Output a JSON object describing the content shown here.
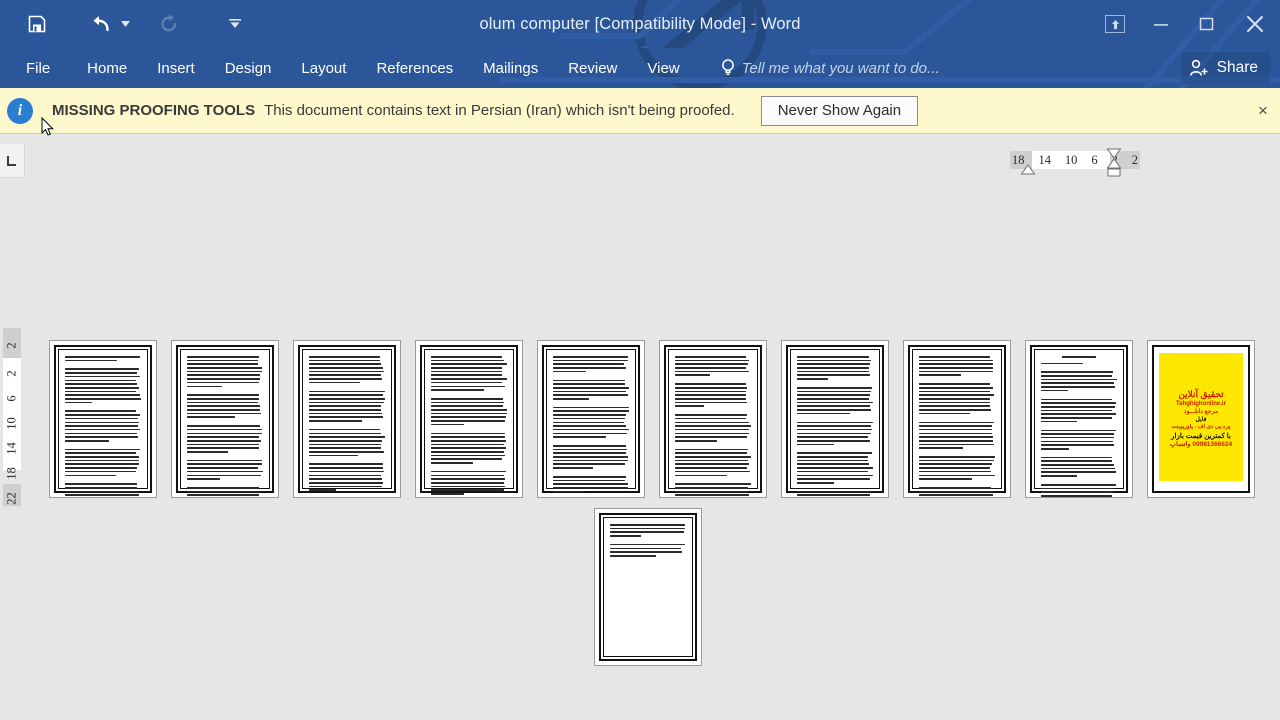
{
  "window": {
    "title": "olum computer [Compatibility Mode] - Word",
    "accent_color": "#2b579a"
  },
  "quick_access": [
    {
      "name": "save-button",
      "icon": "save-icon",
      "label": "Save"
    },
    {
      "name": "undo-button",
      "icon": "undo-icon",
      "label": "Undo"
    },
    {
      "name": "undo-dropdown",
      "icon": "chevron-down-icon",
      "label": "Undo options"
    },
    {
      "name": "redo-button",
      "icon": "redo-icon",
      "label": "Redo",
      "disabled": true
    },
    {
      "name": "customize-qat-button",
      "icon": "customize-qat-icon",
      "label": "Customize Quick Access Toolbar"
    }
  ],
  "window_controls": [
    {
      "name": "ribbon-display-options-button",
      "icon": "ribbon-display-options-icon",
      "label": "Ribbon Display Options"
    },
    {
      "name": "minimize-button",
      "icon": "minimize-icon",
      "label": "Minimize"
    },
    {
      "name": "restore-button",
      "icon": "restore-icon",
      "label": "Restore Down"
    },
    {
      "name": "close-button",
      "icon": "close-icon",
      "label": "Close"
    }
  ],
  "ribbon": {
    "tabs": [
      {
        "label": "File",
        "active": false
      },
      {
        "label": "Home",
        "active": false
      },
      {
        "label": "Insert",
        "active": false
      },
      {
        "label": "Design",
        "active": false
      },
      {
        "label": "Layout",
        "active": false
      },
      {
        "label": "References",
        "active": false
      },
      {
        "label": "Mailings",
        "active": false
      },
      {
        "label": "Review",
        "active": false
      },
      {
        "label": "View",
        "active": false
      }
    ],
    "tell_me_placeholder": "Tell me what you want to do...",
    "share_label": "Share"
  },
  "message_bar": {
    "icon": "info-icon",
    "title": "MISSING PROOFING TOOLS",
    "text": "This document contains text in Persian (Iran) which isn't being proofed.",
    "button_label": "Never Show Again",
    "close_label": "×",
    "background_color": "#fdf9cd"
  },
  "rulers": {
    "corner_icon": "tab-stop-left-icon",
    "horizontal_ticks": [
      "18",
      "14",
      "10",
      "6",
      "2",
      "2"
    ],
    "vertical_ticks": [
      "2",
      "2",
      "6",
      "10",
      "14",
      "18",
      "22"
    ]
  },
  "document": {
    "zoom_view": "multiple-pages",
    "row1": [
      {
        "page": 1,
        "type": "text",
        "lines": 42,
        "paragraphs": [
          2,
          10,
          9,
          8,
          7,
          6
        ]
      },
      {
        "page": 2,
        "type": "text",
        "lines": 41,
        "paragraphs": [
          9,
          7,
          8,
          6,
          6,
          5
        ]
      },
      {
        "page": 3,
        "type": "text",
        "lines": 42,
        "paragraphs": [
          8,
          9,
          8,
          8,
          5,
          4
        ],
        "has_rule": true
      },
      {
        "page": 4,
        "type": "text",
        "lines": 41,
        "paragraphs": [
          10,
          8,
          9,
          7,
          7
        ]
      },
      {
        "page": 5,
        "type": "text",
        "lines": 34,
        "paragraphs": [
          5,
          6,
          9,
          7,
          5
        ]
      },
      {
        "page": 6,
        "type": "text",
        "lines": 36,
        "paragraphs": [
          6,
          7,
          8,
          8,
          5
        ]
      },
      {
        "page": 7,
        "type": "text",
        "lines": 38,
        "paragraphs": [
          7,
          8,
          7,
          9,
          5
        ]
      },
      {
        "page": 8,
        "type": "text",
        "lines": 37,
        "paragraphs": [
          6,
          9,
          8,
          7,
          6
        ]
      },
      {
        "page": 9,
        "type": "text",
        "lines": 30,
        "paragraphs": [
          1,
          6,
          7,
          6,
          6,
          5
        ],
        "has_heading": true
      },
      {
        "page": 10,
        "type": "advertisement"
      }
    ],
    "row2": [
      {
        "page": 11,
        "type": "text",
        "lines": 8,
        "paragraphs": [
          4,
          4
        ]
      }
    ],
    "ad_page": {
      "background_color": "#ffe800",
      "border_color": "#000000",
      "lines": [
        {
          "text": "تحقیق آنلاین",
          "color": "#cc2200",
          "size": 9,
          "style": "title"
        },
        {
          "text": "Tahghighonline.ir",
          "color": "#cc2200",
          "size": 6,
          "style": "url"
        },
        {
          "text": "مرجع دانلـــود",
          "color": "#cc2200",
          "size": 6
        },
        {
          "text": "فایل",
          "color": "#111111",
          "size": 6
        },
        {
          "text": "ورد-پی دی اف - پاورپوینت",
          "color": "#cc2200",
          "size": 5.5
        },
        {
          "text": "با کمترین قیمت بازار",
          "color": "#111111",
          "size": 7
        },
        {
          "text": "09981366624 واتساپ",
          "color": "#cc2200",
          "size": 6.5
        }
      ]
    }
  }
}
